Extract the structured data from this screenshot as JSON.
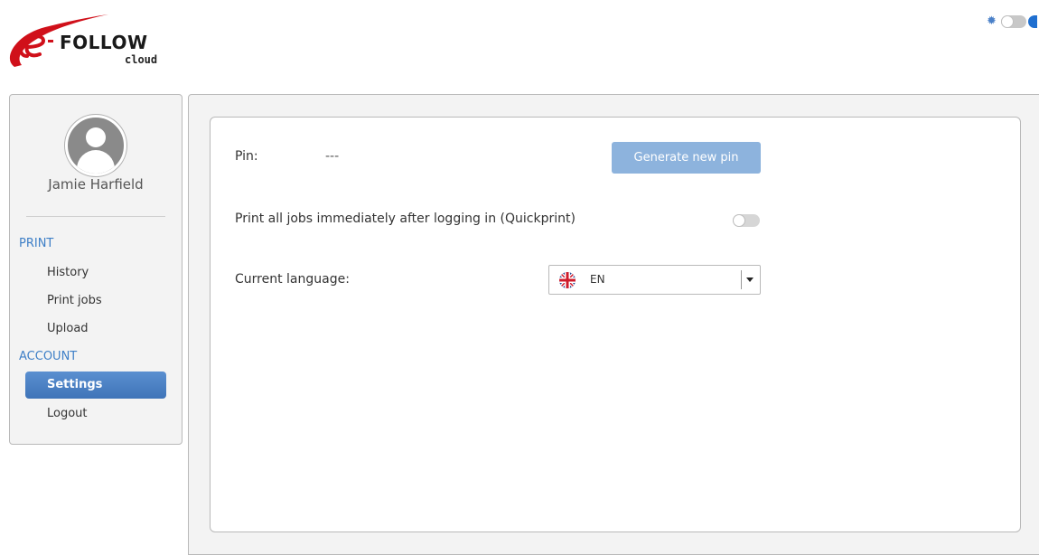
{
  "app": {
    "logo_text": "FOLLOW",
    "logo_sub": "cloud"
  },
  "theme": {
    "toggle_icon": "sun-icon",
    "dark_mode": false
  },
  "sidebar": {
    "user_name": "Jamie Harfield",
    "sections": [
      {
        "label": "PRINT",
        "items": [
          {
            "label": "History",
            "active": false
          },
          {
            "label": "Print jobs",
            "active": false
          },
          {
            "label": "Upload",
            "active": false
          }
        ]
      },
      {
        "label": "ACCOUNT",
        "items": [
          {
            "label": "Settings",
            "active": true
          },
          {
            "label": "Logout",
            "active": false
          }
        ]
      }
    ]
  },
  "settings": {
    "pin_label": "Pin:",
    "pin_value": "---",
    "generate_pin_label": "Generate new pin",
    "quickprint_label": "Print all jobs immediately after logging in (Quickprint)",
    "quickprint_enabled": false,
    "language_label": "Current language:",
    "language_value": "EN",
    "language_flag_icon": "uk-flag-icon"
  },
  "colors": {
    "accent": "#4a7fc0",
    "button_disabled": "#8db3dd",
    "section_label": "#3e7fc7",
    "logo_red": "#d0101a"
  }
}
